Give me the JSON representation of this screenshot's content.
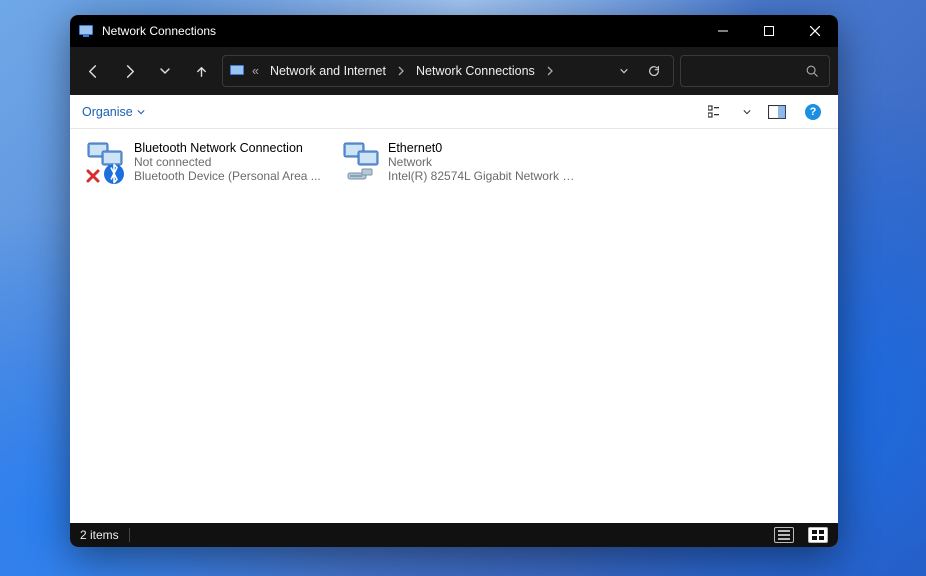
{
  "window": {
    "title": "Network Connections"
  },
  "breadcrumb": {
    "prefix": "«",
    "items": [
      "Network and Internet",
      "Network Connections"
    ]
  },
  "commandbar": {
    "organise_label": "Organise",
    "help_symbol": "?"
  },
  "connections": [
    {
      "name": "Bluetooth Network Connection",
      "status": "Not connected",
      "device": "Bluetooth Device (Personal Area ...",
      "icon": "bluetooth-disconnected"
    },
    {
      "name": "Ethernet0",
      "status": "Network",
      "device": "Intel(R) 82574L Gigabit Network C...",
      "icon": "ethernet"
    }
  ],
  "statusbar": {
    "count_text": "2 items"
  }
}
